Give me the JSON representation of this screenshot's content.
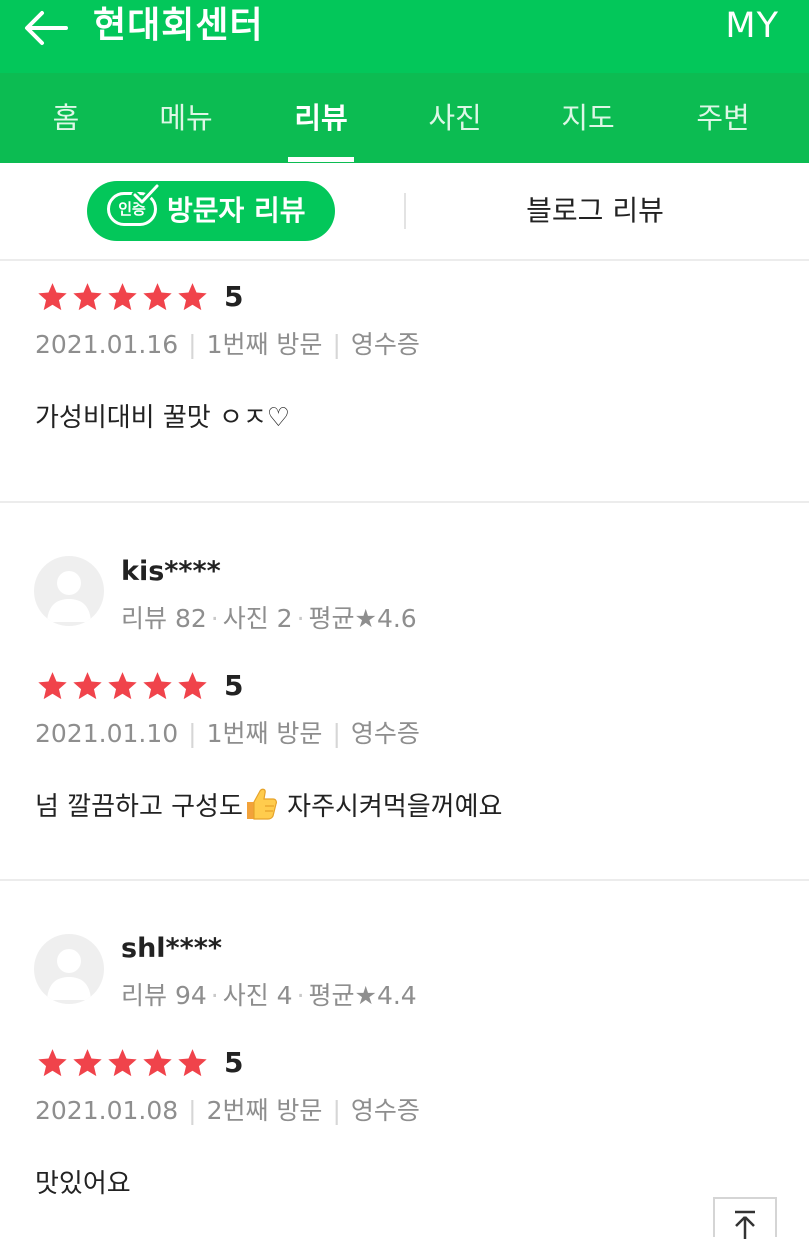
{
  "header": {
    "title": "현대회센터",
    "my_label": "MY"
  },
  "tabs": [
    {
      "label": "홈"
    },
    {
      "label": "메뉴"
    },
    {
      "label": "리뷰"
    },
    {
      "label": "사진"
    },
    {
      "label": "지도"
    },
    {
      "label": "주변"
    }
  ],
  "subtabs": {
    "badge": "인증",
    "visitor_label": "방문자 리뷰",
    "blog_label": "블로그 리뷰"
  },
  "reviews": [
    {
      "rating": "5",
      "date": "2021.01.16",
      "visit": "1번째 방문",
      "receipt": "영수증",
      "text": "가성비대비 꿀맛 ㅇㅈ♡"
    },
    {
      "author": "kis****",
      "stats": {
        "reviews": "리뷰 82",
        "photos": "사진 2",
        "average": "평균★4.6"
      },
      "rating": "5",
      "date": "2021.01.10",
      "visit": "1번째 방문",
      "receipt": "영수증",
      "text_before": "넘 깔끔하고 구성도",
      "text_after": " 자주시켜먹을꺼예요"
    },
    {
      "author": "shl****",
      "stats": {
        "reviews": "리뷰 94",
        "photos": "사진 4",
        "average": "평균★4.4"
      },
      "rating": "5",
      "date": "2021.01.08",
      "visit": "2번째 방문",
      "receipt": "영수증",
      "text": "맛있어요"
    }
  ],
  "colors": {
    "brand_green": "#03c75a",
    "star_red": "#f0434b",
    "muted_text": "#8e8e8e"
  },
  "icons": {
    "back": "arrow-left-icon",
    "star": "star-icon",
    "avatar": "default-user-icon",
    "scroll_top": "scroll-to-top-icon"
  }
}
